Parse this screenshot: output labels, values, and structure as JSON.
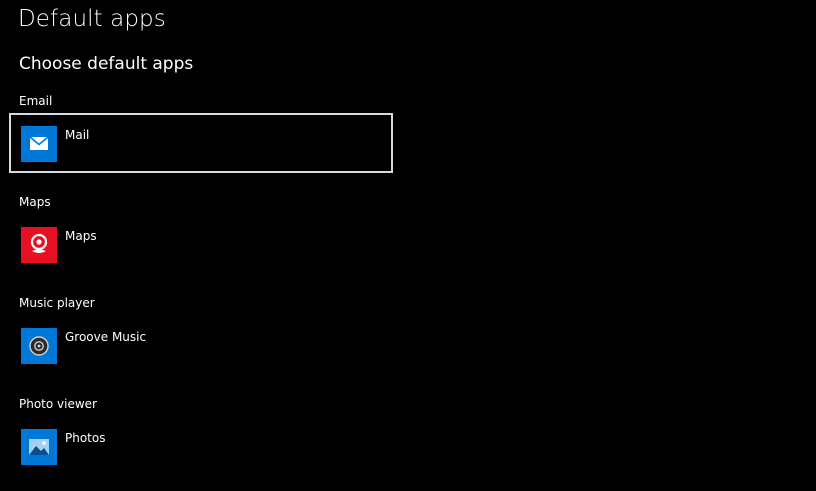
{
  "page": {
    "title": "Default apps",
    "section_title": "Choose default apps"
  },
  "categories": [
    {
      "label": "Email",
      "app": {
        "name": "Mail",
        "icon": "mail-icon",
        "color": "#0078d7"
      }
    },
    {
      "label": "Maps",
      "app": {
        "name": "Maps",
        "icon": "maps-icon",
        "color": "#e81123"
      }
    },
    {
      "label": "Music player",
      "app": {
        "name": "Groove Music",
        "icon": "groove-music-icon",
        "color": "#0078d7"
      }
    },
    {
      "label": "Photo viewer",
      "app": {
        "name": "Photos",
        "icon": "photos-icon",
        "color": "#0078d7"
      }
    }
  ],
  "focused_category": "Email"
}
